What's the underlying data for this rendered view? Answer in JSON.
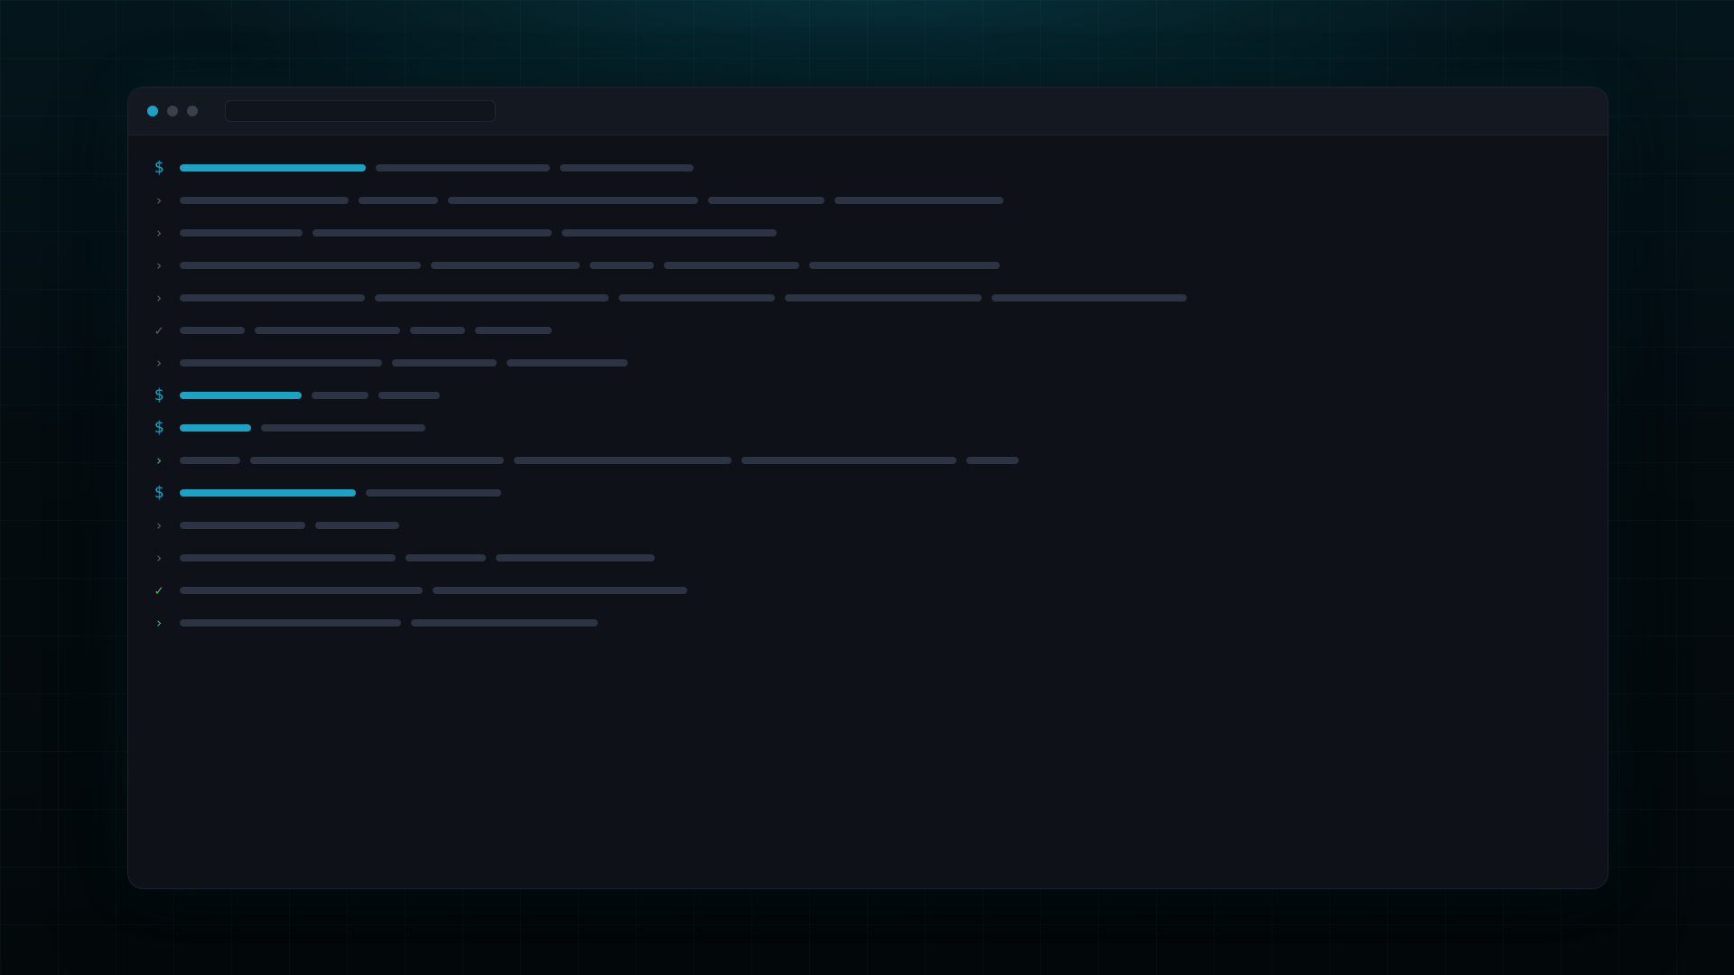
{
  "colors": {
    "accent": "#1aa3c5",
    "placeholder": "#2c3444",
    "success": "#3ec46d",
    "muted_glyph": "#5d6677",
    "dot_active": "#1aa3c5",
    "dot_inactive": "#3a404c"
  },
  "window": {
    "dots": [
      "active",
      "inactive",
      "inactive"
    ],
    "address_bar": {
      "text": ""
    }
  },
  "terminal": {
    "lines": [
      {
        "kind": "prompt",
        "glyph": "$",
        "glyph_tone": "accent",
        "segments": [
          {
            "w": 206,
            "c": "accent"
          },
          {
            "w": 193,
            "c": "placeholder"
          },
          {
            "w": 148,
            "c": "placeholder"
          }
        ]
      },
      {
        "kind": "output",
        "glyph": "›",
        "glyph_tone": "muted",
        "segments": [
          {
            "w": 187,
            "c": "placeholder"
          },
          {
            "w": 88,
            "c": "placeholder"
          },
          {
            "w": 277,
            "c": "placeholder"
          },
          {
            "w": 129,
            "c": "placeholder"
          },
          {
            "w": 187,
            "c": "placeholder"
          }
        ]
      },
      {
        "kind": "output",
        "glyph": "›",
        "glyph_tone": "muted",
        "segments": [
          {
            "w": 136,
            "c": "placeholder"
          },
          {
            "w": 265,
            "c": "placeholder"
          },
          {
            "w": 238,
            "c": "placeholder"
          }
        ]
      },
      {
        "kind": "output",
        "glyph": "›",
        "glyph_tone": "muted",
        "segments": [
          {
            "w": 267,
            "c": "placeholder"
          },
          {
            "w": 165,
            "c": "placeholder"
          },
          {
            "w": 71,
            "c": "placeholder"
          },
          {
            "w": 150,
            "c": "placeholder"
          },
          {
            "w": 211,
            "c": "placeholder"
          }
        ]
      },
      {
        "kind": "output",
        "glyph": "›",
        "glyph_tone": "muted",
        "segments": [
          {
            "w": 205,
            "c": "placeholder"
          },
          {
            "w": 259,
            "c": "placeholder"
          },
          {
            "w": 173,
            "c": "placeholder"
          },
          {
            "w": 218,
            "c": "placeholder"
          },
          {
            "w": 216,
            "c": "placeholder"
          }
        ]
      },
      {
        "kind": "output",
        "glyph": "✓",
        "glyph_tone": "muted",
        "segments": [
          {
            "w": 72,
            "c": "placeholder"
          },
          {
            "w": 161,
            "c": "placeholder"
          },
          {
            "w": 61,
            "c": "placeholder"
          },
          {
            "w": 85,
            "c": "placeholder"
          }
        ]
      },
      {
        "kind": "output",
        "glyph": "›",
        "glyph_tone": "muted",
        "segments": [
          {
            "w": 224,
            "c": "placeholder"
          },
          {
            "w": 116,
            "c": "placeholder"
          },
          {
            "w": 134,
            "c": "placeholder"
          }
        ]
      },
      {
        "kind": "prompt",
        "glyph": "$",
        "glyph_tone": "accent",
        "segments": [
          {
            "w": 135,
            "c": "accent"
          },
          {
            "w": 63,
            "c": "placeholder"
          },
          {
            "w": 68,
            "c": "placeholder"
          }
        ]
      },
      {
        "kind": "prompt",
        "glyph": "$",
        "glyph_tone": "accent",
        "segments": [
          {
            "w": 79,
            "c": "accent"
          },
          {
            "w": 182,
            "c": "placeholder"
          }
        ]
      },
      {
        "kind": "output",
        "glyph": "›",
        "glyph_tone": "success",
        "segments": [
          {
            "w": 67,
            "c": "placeholder"
          },
          {
            "w": 281,
            "c": "placeholder"
          },
          {
            "w": 241,
            "c": "placeholder"
          },
          {
            "w": 238,
            "c": "placeholder"
          },
          {
            "w": 58,
            "c": "placeholder"
          }
        ]
      },
      {
        "kind": "prompt",
        "glyph": "$",
        "glyph_tone": "accent",
        "segments": [
          {
            "w": 195,
            "c": "accent"
          },
          {
            "w": 150,
            "c": "placeholder"
          }
        ]
      },
      {
        "kind": "output",
        "glyph": "›",
        "glyph_tone": "muted",
        "segments": [
          {
            "w": 139,
            "c": "placeholder"
          },
          {
            "w": 93,
            "c": "placeholder"
          }
        ]
      },
      {
        "kind": "output",
        "glyph": "›",
        "glyph_tone": "muted",
        "segments": [
          {
            "w": 239,
            "c": "placeholder"
          },
          {
            "w": 89,
            "c": "placeholder"
          },
          {
            "w": 176,
            "c": "placeholder"
          }
        ]
      },
      {
        "kind": "output",
        "glyph": "✓",
        "glyph_tone": "success",
        "segments": [
          {
            "w": 269,
            "c": "placeholder"
          },
          {
            "w": 282,
            "c": "placeholder"
          }
        ]
      },
      {
        "kind": "output",
        "glyph": "›",
        "glyph_tone": "success",
        "segments": [
          {
            "w": 245,
            "c": "placeholder"
          },
          {
            "w": 207,
            "c": "placeholder"
          }
        ]
      }
    ]
  }
}
